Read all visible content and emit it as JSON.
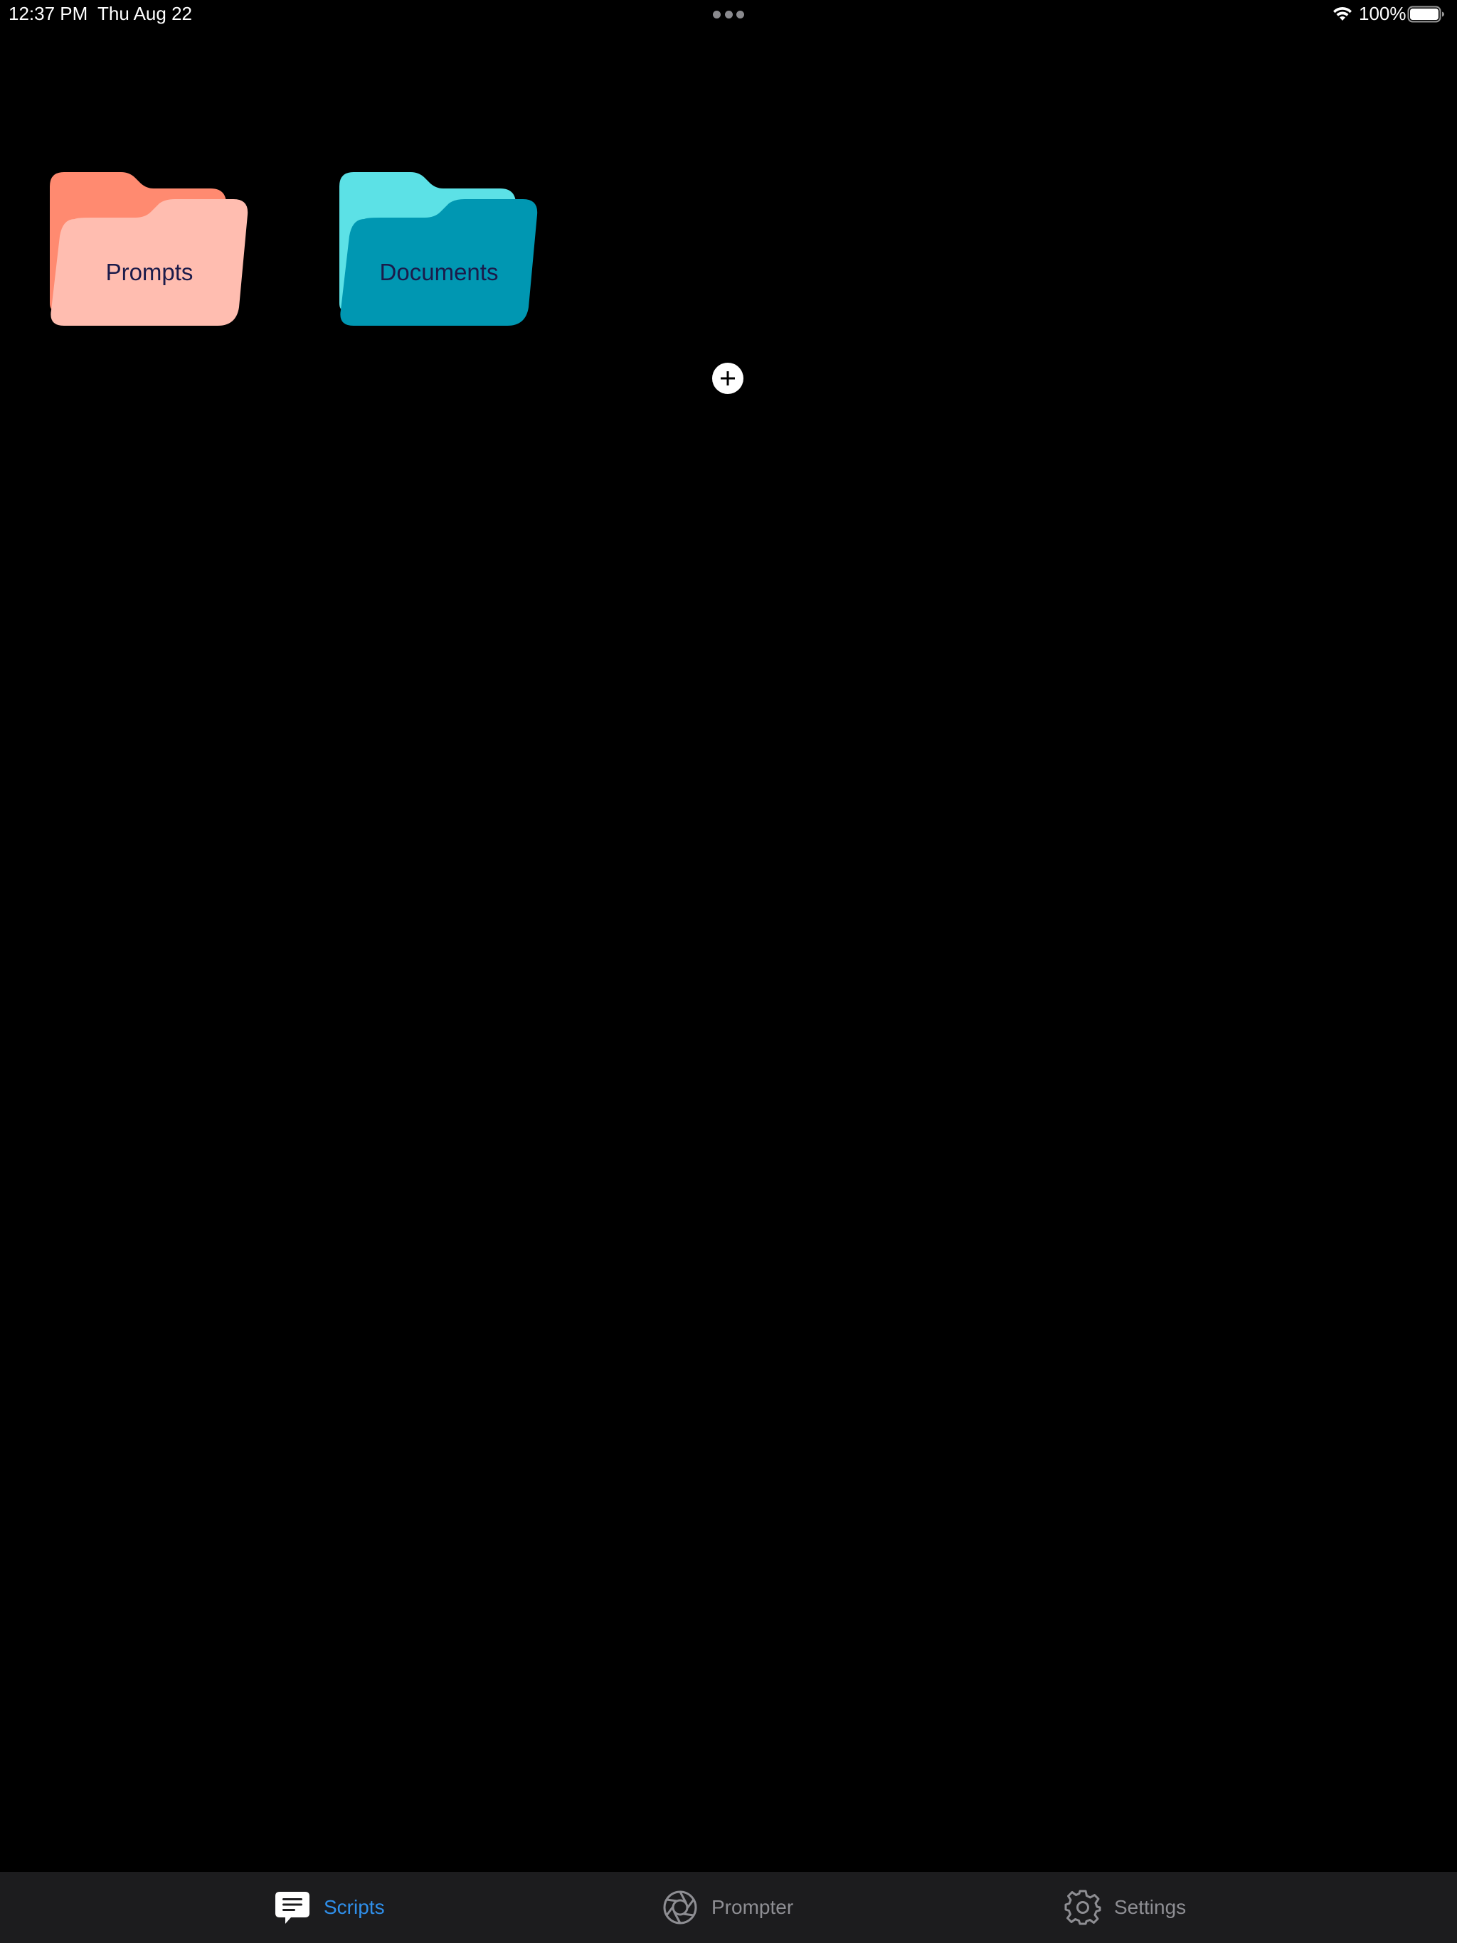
{
  "status_bar": {
    "time": "12:37 PM",
    "date": "Thu Aug 22",
    "battery_percent": "100%",
    "battery_level": 1.0,
    "icons": [
      "multitasking-dots-icon",
      "wifi-icon",
      "battery-icon"
    ]
  },
  "folders": [
    {
      "label": "Prompts",
      "back_color": "#ff8a70",
      "front_color": "#ffbdb0",
      "icon": "folder-icon"
    },
    {
      "label": "Documents",
      "back_color": "#5ce1e6",
      "front_color": "#0097b2",
      "icon": "folder-icon"
    }
  ],
  "add_button": {
    "icon": "plus-circle-icon"
  },
  "tab_bar": {
    "tabs": [
      {
        "label": "Scripts",
        "icon": "message-lines-icon",
        "selected": true
      },
      {
        "label": "Prompter",
        "icon": "aperture-icon",
        "selected": false
      },
      {
        "label": "Settings",
        "icon": "gear-icon",
        "selected": false
      }
    ],
    "active_color": "#2f8fea",
    "inactive_color": "#8e8e93"
  }
}
